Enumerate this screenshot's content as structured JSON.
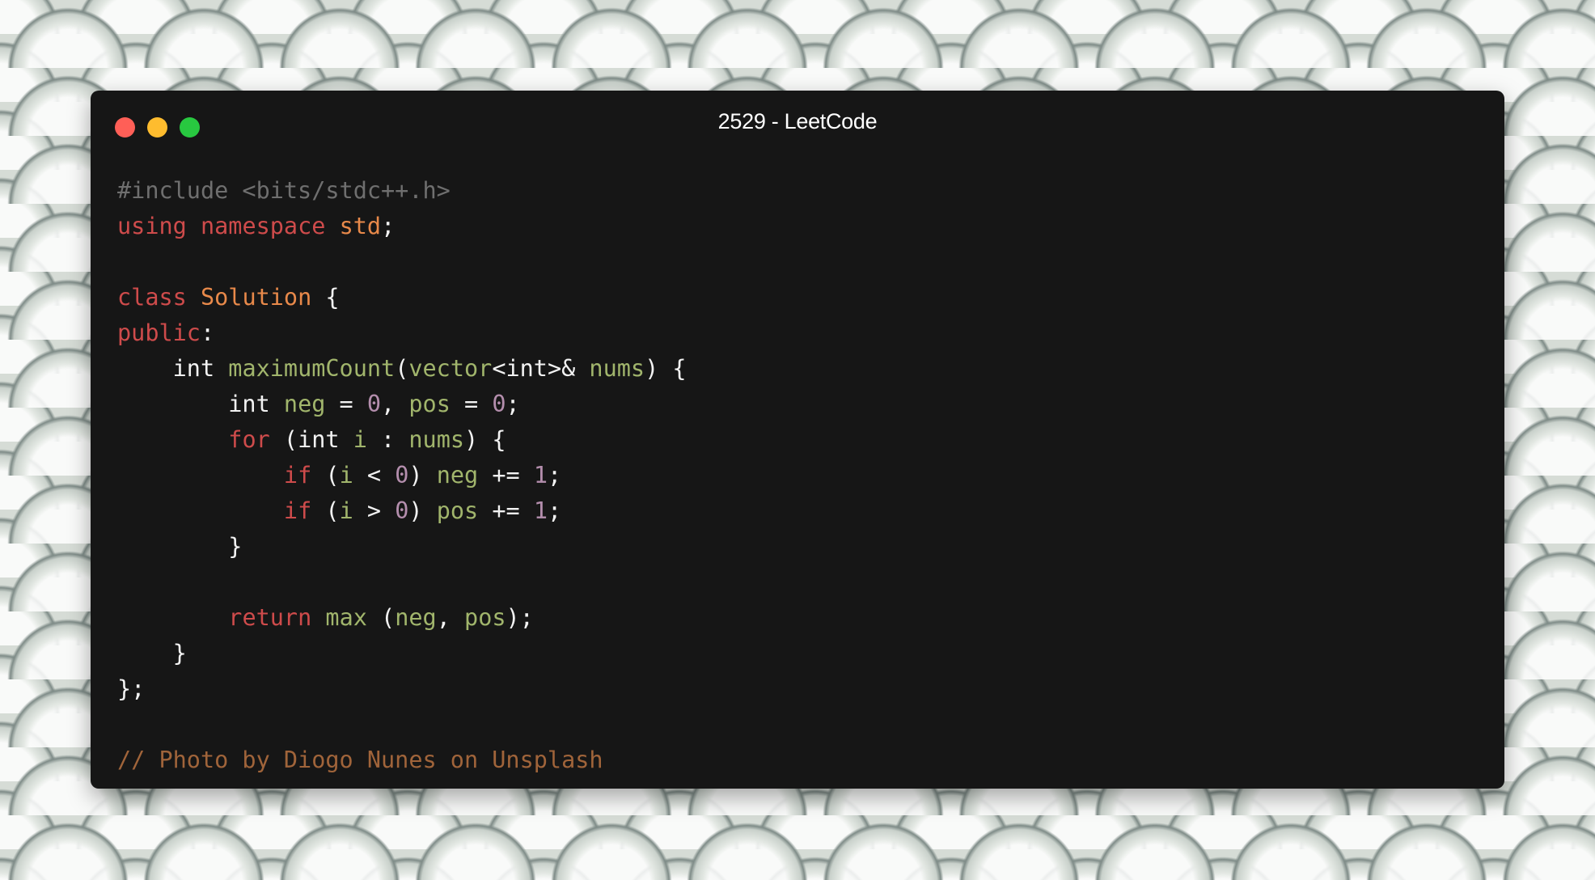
{
  "window": {
    "title": "2529 - LeetCode"
  },
  "colors": {
    "window_bg": "#161616",
    "close": "#ff5f57",
    "minimize": "#febc2e",
    "maximize": "#28c840",
    "directive": "#6f6f6f",
    "keyword": "#ce4b4b",
    "class_name": "#e8894a",
    "identifier": "#a1b56c",
    "number": "#b48ead",
    "comment": "#a0643a",
    "plain": "#f2f2f2"
  },
  "code": {
    "lines": [
      [
        {
          "t": "#include <bits/stdc++.h>",
          "c": "dir"
        }
      ],
      [
        {
          "t": "using",
          "c": "kw"
        },
        {
          "t": " ",
          "c": "plain"
        },
        {
          "t": "namespace",
          "c": "kw"
        },
        {
          "t": " ",
          "c": "plain"
        },
        {
          "t": "std",
          "c": "cls"
        },
        {
          "t": ";",
          "c": "plain"
        }
      ],
      [],
      [
        {
          "t": "class",
          "c": "kw"
        },
        {
          "t": " ",
          "c": "plain"
        },
        {
          "t": "Solution",
          "c": "cls"
        },
        {
          "t": " {",
          "c": "plain"
        }
      ],
      [
        {
          "t": "public",
          "c": "kw"
        },
        {
          "t": ":",
          "c": "plain"
        }
      ],
      [
        {
          "t": "    int ",
          "c": "plain"
        },
        {
          "t": "maximumCount",
          "c": "fn"
        },
        {
          "t": "(",
          "c": "plain"
        },
        {
          "t": "vector",
          "c": "fn"
        },
        {
          "t": "<int>& ",
          "c": "plain"
        },
        {
          "t": "nums",
          "c": "var"
        },
        {
          "t": ") {",
          "c": "plain"
        }
      ],
      [
        {
          "t": "        int ",
          "c": "plain"
        },
        {
          "t": "neg",
          "c": "var"
        },
        {
          "t": " = ",
          "c": "plain"
        },
        {
          "t": "0",
          "c": "num"
        },
        {
          "t": ", ",
          "c": "plain"
        },
        {
          "t": "pos",
          "c": "var"
        },
        {
          "t": " = ",
          "c": "plain"
        },
        {
          "t": "0",
          "c": "num"
        },
        {
          "t": ";",
          "c": "plain"
        }
      ],
      [
        {
          "t": "        ",
          "c": "plain"
        },
        {
          "t": "for",
          "c": "kw"
        },
        {
          "t": " (int ",
          "c": "plain"
        },
        {
          "t": "i",
          "c": "var"
        },
        {
          "t": " : ",
          "c": "plain"
        },
        {
          "t": "nums",
          "c": "var"
        },
        {
          "t": ") {",
          "c": "plain"
        }
      ],
      [
        {
          "t": "            ",
          "c": "plain"
        },
        {
          "t": "if",
          "c": "kw"
        },
        {
          "t": " (",
          "c": "plain"
        },
        {
          "t": "i",
          "c": "var"
        },
        {
          "t": " < ",
          "c": "plain"
        },
        {
          "t": "0",
          "c": "num"
        },
        {
          "t": ") ",
          "c": "plain"
        },
        {
          "t": "neg",
          "c": "var"
        },
        {
          "t": " += ",
          "c": "plain"
        },
        {
          "t": "1",
          "c": "num"
        },
        {
          "t": ";",
          "c": "plain"
        }
      ],
      [
        {
          "t": "            ",
          "c": "plain"
        },
        {
          "t": "if",
          "c": "kw"
        },
        {
          "t": " (",
          "c": "plain"
        },
        {
          "t": "i",
          "c": "var"
        },
        {
          "t": " > ",
          "c": "plain"
        },
        {
          "t": "0",
          "c": "num"
        },
        {
          "t": ") ",
          "c": "plain"
        },
        {
          "t": "pos",
          "c": "var"
        },
        {
          "t": " += ",
          "c": "plain"
        },
        {
          "t": "1",
          "c": "num"
        },
        {
          "t": ";",
          "c": "plain"
        }
      ],
      [
        {
          "t": "        }",
          "c": "plain"
        }
      ],
      [],
      [
        {
          "t": "        ",
          "c": "plain"
        },
        {
          "t": "return",
          "c": "kw"
        },
        {
          "t": " ",
          "c": "plain"
        },
        {
          "t": "max",
          "c": "fn"
        },
        {
          "t": " (",
          "c": "plain"
        },
        {
          "t": "neg",
          "c": "var"
        },
        {
          "t": ", ",
          "c": "plain"
        },
        {
          "t": "pos",
          "c": "var"
        },
        {
          "t": ");",
          "c": "plain"
        }
      ],
      [
        {
          "t": "    }",
          "c": "plain"
        }
      ],
      [
        {
          "t": "};",
          "c": "plain"
        }
      ],
      [],
      [
        {
          "t": "// Photo by Diogo Nunes on Unsplash",
          "c": "com"
        }
      ]
    ]
  }
}
